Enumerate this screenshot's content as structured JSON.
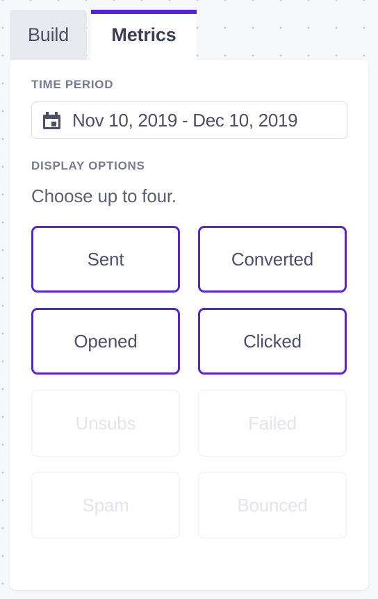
{
  "tabs": [
    {
      "id": "build",
      "label": "Build",
      "active": false
    },
    {
      "id": "metrics",
      "label": "Metrics",
      "active": true
    }
  ],
  "panel": {
    "time_period": {
      "label": "TIME PERIOD",
      "icon": "calendar-icon",
      "value": "Nov 10, 2019 - Dec 10, 2019"
    },
    "display_options": {
      "label": "DISPLAY OPTIONS",
      "hint": "Choose up to four.",
      "metrics": [
        {
          "id": "sent",
          "label": "Sent",
          "state": "selected"
        },
        {
          "id": "converted",
          "label": "Converted",
          "state": "selected"
        },
        {
          "id": "opened",
          "label": "Opened",
          "state": "selected"
        },
        {
          "id": "clicked",
          "label": "Clicked",
          "state": "selected"
        },
        {
          "id": "unsubs",
          "label": "Unsubs",
          "state": "disabled"
        },
        {
          "id": "failed",
          "label": "Failed",
          "state": "disabled"
        },
        {
          "id": "spam",
          "label": "Spam",
          "state": "disabled"
        },
        {
          "id": "bounced",
          "label": "Bounced",
          "state": "disabled"
        }
      ]
    }
  },
  "colors": {
    "accent": "#5a22cd",
    "page_background": "#f7f8fa",
    "card_background": "#ffffff",
    "inactive_tab_background": "#e8e9ef",
    "label_text": "#767a93",
    "body_text": "#4c4f66",
    "disabled_text": "#e3e4ec",
    "disabled_border": "#eeeff4",
    "input_border": "#dcdee6",
    "dot_grid": "#c8cbd6"
  }
}
